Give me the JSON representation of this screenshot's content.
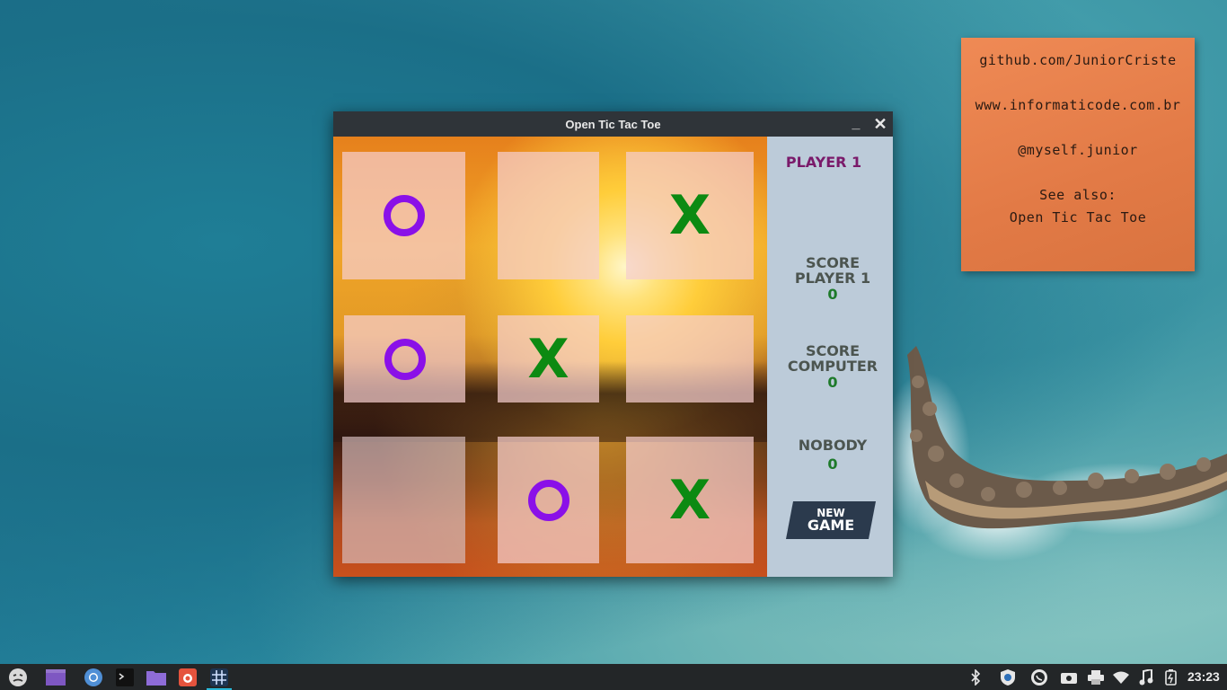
{
  "note": {
    "lines": [
      "github.com/JuniorCriste",
      "www.informaticode.com.br",
      "@myself.junior",
      "See also:",
      "Open Tic Tac Toe"
    ]
  },
  "window": {
    "title": "Open Tic Tac Toe",
    "minimize_glyph": "_",
    "close_glyph": "✕"
  },
  "board": {
    "cells": [
      "O",
      "",
      "X",
      "O",
      "X",
      "",
      "",
      "O",
      "X"
    ]
  },
  "side": {
    "turn": "PLAYER 1",
    "score_player_label": [
      "SCORE",
      "PLAYER 1"
    ],
    "score_player_value": "0",
    "score_computer_label": [
      "SCORE",
      "COMPUTER"
    ],
    "score_computer_value": "0",
    "nobody_label": "NOBODY",
    "nobody_value": "0",
    "new_game_line1": "NEW",
    "new_game_line2": "GAME"
  },
  "taskbar": {
    "apps": [
      "app-menu-icon",
      "workspace-icon",
      "chromium-icon",
      "terminal-icon",
      "file-manager-icon",
      "screenshot-tool-icon",
      "tictactoe-app-icon"
    ],
    "tray": [
      "bluetooth-icon",
      "shield-update-icon",
      "whatsapp-icon",
      "camera-icon",
      "printer-icon",
      "wifi-icon",
      "music-icon",
      "battery-icon"
    ],
    "clock": "23:23"
  },
  "colors": {
    "o_mark": "#8a10e8",
    "x_mark": "#0c8a12",
    "turn_text": "#7a1a6a",
    "score_value": "#1d7a2a",
    "note_bg": "#e27a46",
    "sidebar_bg": "#bccbd9"
  }
}
